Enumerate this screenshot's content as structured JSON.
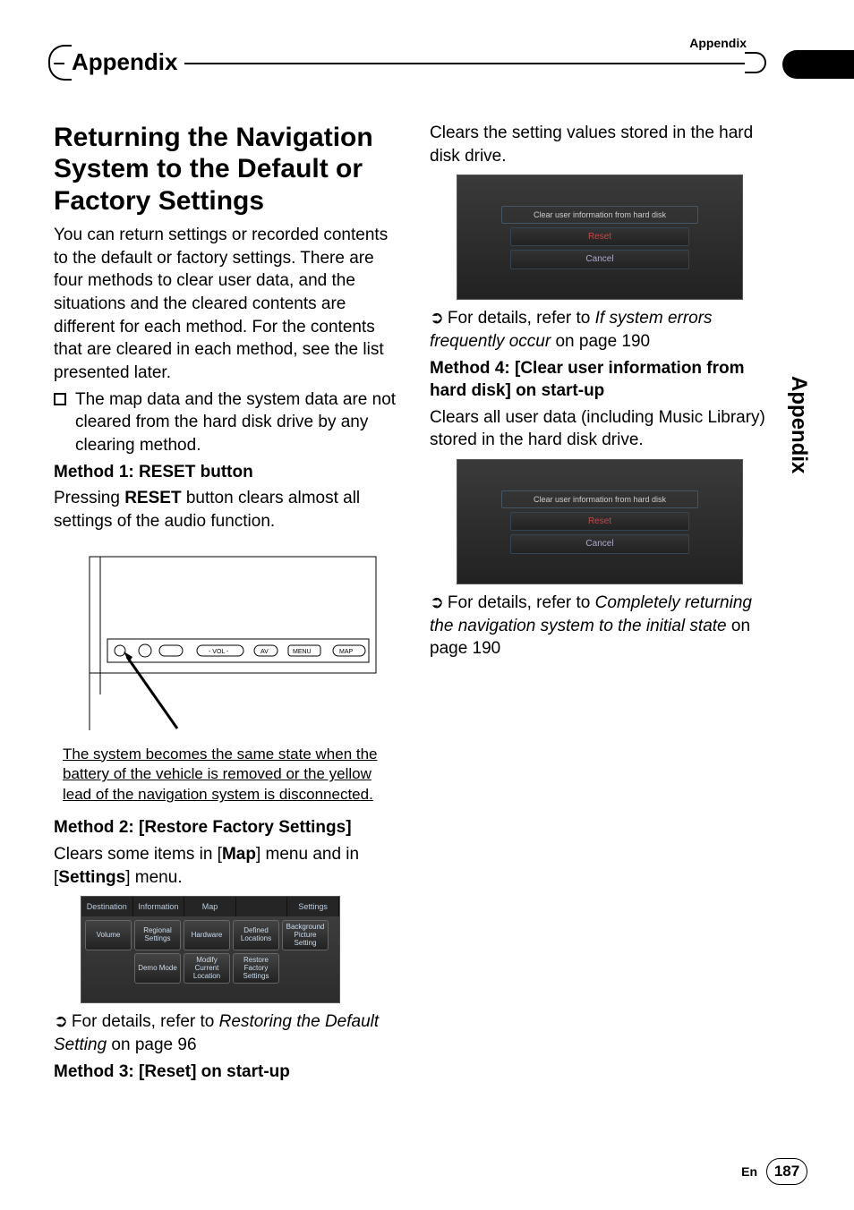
{
  "header": {
    "top_right_label": "Appendix",
    "banner_title": "Appendix"
  },
  "left": {
    "h1": "Returning the Navigation System to the Default or Factory Settings",
    "intro": "You can return settings or recorded contents to the default or factory settings. There are four methods to clear user data, and the situations and the cleared contents are different for each method. For the contents that are cleared in each method, see the list presented later.",
    "bullet": "The map data and the system data are not cleared from the hard disk drive by any clearing method.",
    "m1_title": "Method 1: RESET button",
    "m1_text_a": "Pressing ",
    "m1_reset": "RESET",
    "m1_text_b": " button clears almost all settings of the audio function.",
    "fig1_caption": "The system becomes the same state when the battery of the vehicle is removed or the yellow lead of the navigation system is disconnected.",
    "m2_title": "Method 2: [Restore Factory Settings]",
    "m2_text_a": "Clears some items in [",
    "m2_map": "Map",
    "m2_text_b": "] menu and in [",
    "m2_settings": "Settings",
    "m2_text_c": "] menu.",
    "ss_tabs": [
      "Destination",
      "Information",
      "Map",
      "",
      "Settings"
    ],
    "ss_buttons": [
      "Volume",
      "Regional Settings",
      "Hardware",
      "Defined Locations",
      "Background Picture Setting",
      "",
      "Demo Mode",
      "Modify Current Location",
      "Restore Factory Settings"
    ],
    "ref2_a": "For details, refer to ",
    "ref2_it": "Restoring the Default Setting",
    "ref2_b": " on page 96",
    "m3_title": "Method 3: [Reset] on start-up"
  },
  "right": {
    "p1": "Clears the setting values stored in the hard disk drive.",
    "dlg_label": "Clear user information from hard disk",
    "dlg_reset": "Reset",
    "dlg_cancel": "Cancel",
    "ref3_a": "For details, refer to ",
    "ref3_it": "If system errors frequently occur",
    "ref3_b": " on page 190",
    "m4_title": "Method 4: [Clear user information from hard disk] on start-up",
    "m4_text": "Clears all user data (including Music Library) stored in the hard disk drive.",
    "ref4_a": "For details, refer to ",
    "ref4_it": "Completely returning the navigation system to the initial state",
    "ref4_b": " on page 190"
  },
  "side_label": "Appendix",
  "footer": {
    "lang": "En",
    "page": "187"
  }
}
